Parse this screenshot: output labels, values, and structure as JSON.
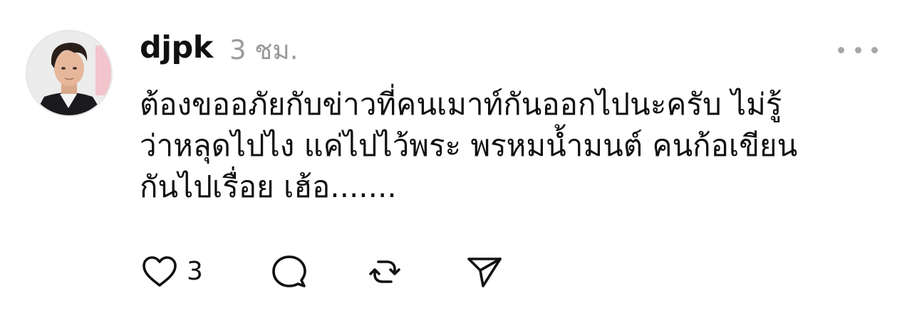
{
  "post": {
    "username": "djpk",
    "timestamp": "3 ชม.",
    "text_lines": [
      "ต้องขออภัยกับข่าวที่คนเมาท์กันออกไปนะครับ ไม่รู้",
      "ว่าหลุดไปไง แค่ไปไว้พระ พรหมน้ำมนต์ คนก้อเขียน",
      "กันไปเรื่อย เฮ้อ......."
    ],
    "like_count": "3"
  },
  "icons": {
    "more": "more-horizontal-icon",
    "like": "heart-icon",
    "comment": "comment-bubble-icon",
    "repost": "repost-icon",
    "share": "send-icon"
  },
  "colors": {
    "text": "#111111",
    "muted": "#9a9a9a",
    "icon": "#111111"
  }
}
